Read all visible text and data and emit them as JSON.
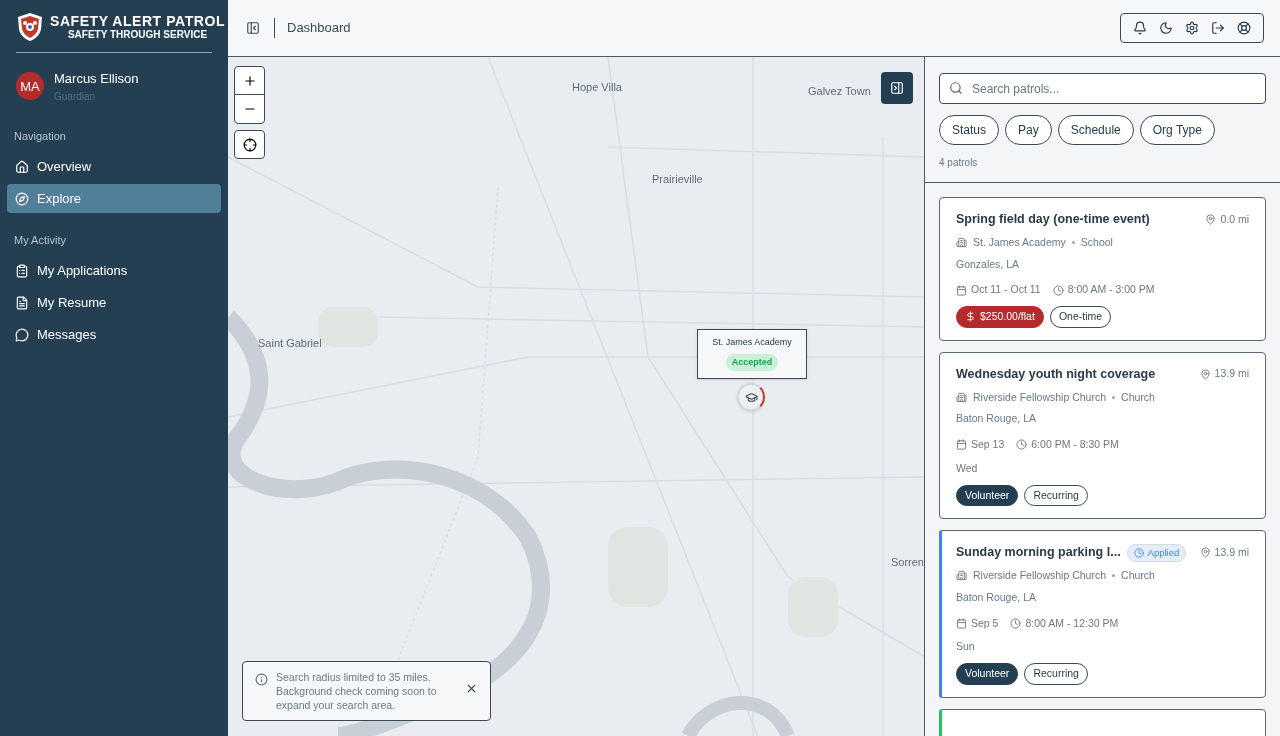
{
  "brand": {
    "title": "SAFETY ALERT PATROL",
    "tagline": "SAFETY THROUGH SERVICE"
  },
  "user": {
    "initials": "MA",
    "name": "Marcus Ellison",
    "role": "Guardian"
  },
  "nav_sections": [
    {
      "heading": "Navigation",
      "items": [
        {
          "label": "Overview",
          "selected": false
        },
        {
          "label": "Explore",
          "selected": true
        }
      ]
    },
    {
      "heading": "My Activity",
      "items": [
        {
          "label": "My Applications",
          "selected": false
        },
        {
          "label": "My Resume",
          "selected": false
        },
        {
          "label": "Messages",
          "selected": false
        }
      ]
    }
  ],
  "header": {
    "breadcrumb": "Dashboard"
  },
  "map": {
    "labels": [
      "Hope Villa",
      "Galvez Town",
      "Prairieville",
      "Saint Gabriel",
      "Sorren"
    ],
    "popup": {
      "title": "St. James Academy",
      "status": "Accepted"
    },
    "notice": "Search radius limited to 35 miles. Background check coming soon to expand your search area."
  },
  "search": {
    "placeholder": "Search patrols..."
  },
  "filters": [
    "Status",
    "Pay",
    "Schedule",
    "Org Type"
  ],
  "count": "4 patrols",
  "patrols": [
    {
      "title": "Spring field day (one-time event)",
      "distance": "0.0 mi",
      "org": "St. James Academy",
      "org_type": "School",
      "location": "Gonzales, LA",
      "date": "Oct 11 - Oct 11",
      "time": "8:00 AM - 3:00 PM",
      "tags": [
        {
          "kind": "pay",
          "label": "$250.00/flat"
        },
        {
          "kind": "outline",
          "label": "One-time"
        }
      ]
    },
    {
      "title": "Wednesday youth night coverage",
      "distance": "13.9 mi",
      "org": "Riverside Fellowship Church",
      "org_type": "Church",
      "location": "Baton Rouge, LA",
      "date": "Sep 13",
      "time": "6:00 PM - 8:30 PM",
      "days": "Wed",
      "tags": [
        {
          "kind": "volunteer",
          "label": "Volunteer"
        },
        {
          "kind": "outline",
          "label": "Recurring"
        }
      ]
    },
    {
      "title": "Sunday morning parking l...",
      "status": "Applied",
      "color": "#3b82f6",
      "distance": "13.9 mi",
      "org": "Riverside Fellowship Church",
      "org_type": "Church",
      "location": "Baton Rouge, LA",
      "date": "Sep 5",
      "time": "8:00 AM - 12:30 PM",
      "days": "Sun",
      "tags": [
        {
          "kind": "volunteer",
          "label": "Volunteer"
        },
        {
          "kind": "outline",
          "label": "Recurring"
        }
      ]
    },
    {
      "color": "#22c55e"
    }
  ]
}
